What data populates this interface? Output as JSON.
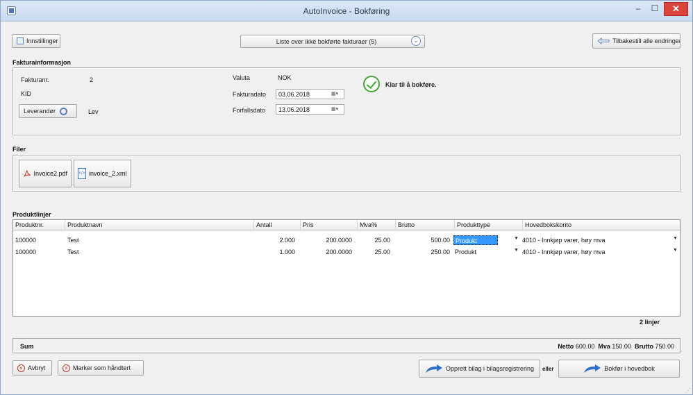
{
  "window": {
    "title": "AutoInvoice - Bokføring",
    "min_glyph": "–",
    "max_glyph": "☐",
    "close_glyph": "✕"
  },
  "toolbar": {
    "settings_label": "Innstillinger",
    "unposted_list_label": "Liste over ikke bokførte fakturaer (5)",
    "reset_label": "Tilbakestill alle endringer"
  },
  "invoice_info": {
    "section_title": "Fakturainformasjon",
    "invoice_no_label": "Fakturanr.",
    "invoice_no": "2",
    "kid_label": "KID",
    "kid": "",
    "supplier_button_label": "Leverandør",
    "supplier_name": "Lev",
    "currency_label": "Valuta",
    "currency": "NOK",
    "invoice_date_label": "Fakturadato",
    "invoice_date": "03.06.2018",
    "due_date_label": "Forfallsdato",
    "due_date": "13.06.2018",
    "status_text": "Klar til å bokføre."
  },
  "files": {
    "section_title": "Filer",
    "items": [
      {
        "name": "Invoice2.pdf",
        "icon": "pdf-icon"
      },
      {
        "name": "invoice_2.xml",
        "icon": "xml-file-icon"
      }
    ]
  },
  "product_lines": {
    "section_title": "Produktlinjer",
    "columns": [
      "Produktnr.",
      "Produktnavn",
      "Antall",
      "Pris",
      "Mva%",
      "Brutto",
      "Produkttype",
      "Hovedbokskonto"
    ],
    "rows": [
      {
        "product_no": "100000",
        "name": "Test",
        "qty": "2.000",
        "price": "200.0000",
        "vat": "25.00",
        "gross": "500.00",
        "type": "Produkt",
        "account": "4010 - Innkjøp varer, høy mva"
      },
      {
        "product_no": "100000",
        "name": "Test",
        "qty": "1.000",
        "price": "200.0000",
        "vat": "25.00",
        "gross": "250.00",
        "type": "Produkt",
        "account": "4010 - Innkjøp varer, høy mva"
      }
    ],
    "line_count": "2 linjer"
  },
  "summary": {
    "label": "Sum",
    "net_label": "Netto",
    "net": "600.00",
    "vat_label": "Mva",
    "vat": "150.00",
    "gross_label": "Brutto",
    "gross": "750.00"
  },
  "footer": {
    "cancel_label": "Avbryt",
    "mark_handled_label": "Marker som håndtert",
    "create_voucher_label": "Opprett bilag i bilagsregistrering",
    "or_text": "eller",
    "post_ledger_label": "Bokfør i hovedbok"
  },
  "colors": {
    "accent": "#3399ff",
    "ok_green": "#4aa33b",
    "close_red": "#d9443c"
  }
}
